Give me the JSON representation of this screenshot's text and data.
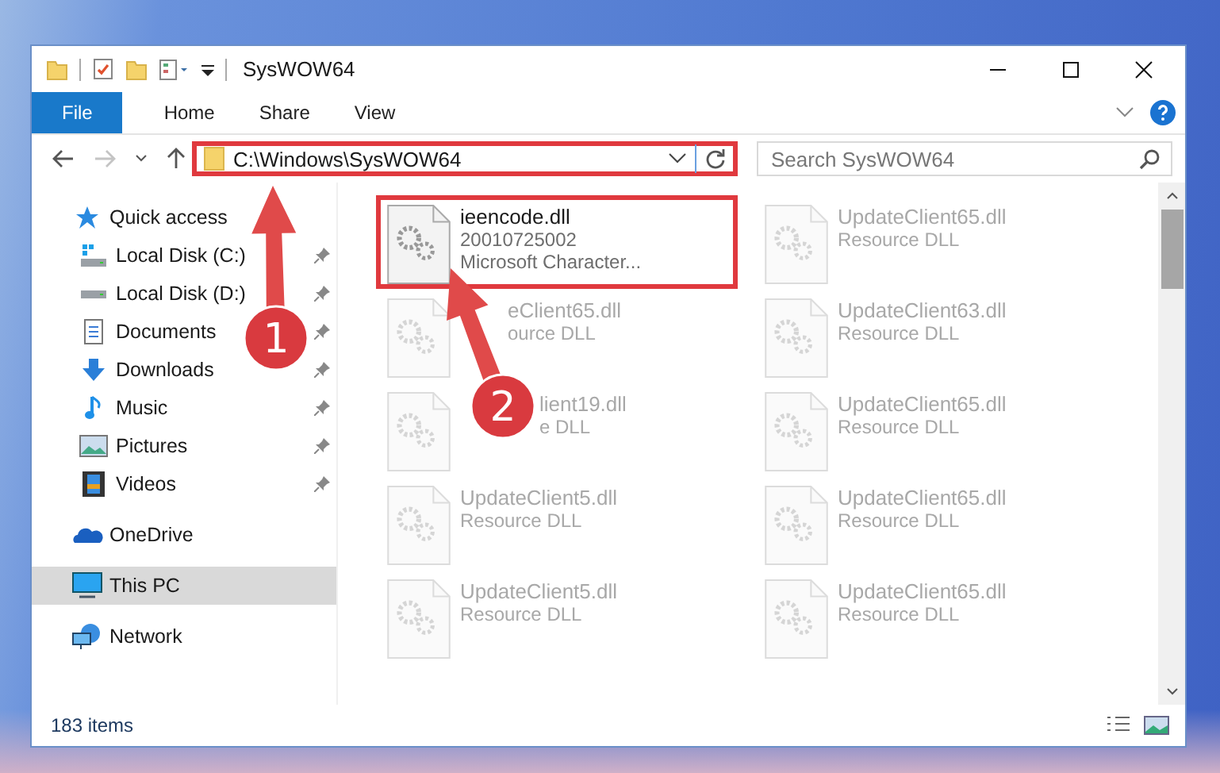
{
  "window": {
    "title": "SysWOW64"
  },
  "ribbon": {
    "tabs": [
      {
        "label": "File",
        "selected": true
      },
      {
        "label": "Home",
        "selected": false
      },
      {
        "label": "Share",
        "selected": false
      },
      {
        "label": "View",
        "selected": false
      }
    ]
  },
  "address": {
    "path": "C:\\Windows\\SysWOW64",
    "highlighted": true
  },
  "search": {
    "placeholder": "Search SysWOW64"
  },
  "sidebar": {
    "items": [
      {
        "label": "Quick access",
        "kind": "star",
        "selected": false,
        "children": [
          {
            "label": "Local Disk (C:)",
            "kind": "windows-drive",
            "pinned": true,
            "selected": false
          },
          {
            "label": "Local Disk (D:)",
            "kind": "drive",
            "pinned": true,
            "selected": false
          },
          {
            "label": "Documents",
            "kind": "documents",
            "pinned": true,
            "selected": false
          },
          {
            "label": "Downloads",
            "kind": "downloads",
            "pinned": true,
            "selected": false
          },
          {
            "label": "Music",
            "kind": "music",
            "pinned": true,
            "selected": false
          },
          {
            "label": "Pictures",
            "kind": "pictures",
            "pinned": true,
            "selected": false
          },
          {
            "label": "Videos",
            "kind": "videos",
            "pinned": true,
            "selected": false
          }
        ]
      },
      {
        "label": "OneDrive",
        "kind": "cloud",
        "selected": false
      },
      {
        "label": "This PC",
        "kind": "pc",
        "selected": true
      },
      {
        "label": "Network",
        "kind": "network",
        "selected": false
      }
    ]
  },
  "files": [
    {
      "name": "ieencode.dll",
      "lines": [
        "20010725002",
        "Microsoft Character..."
      ],
      "highlighted": true,
      "faded": false
    },
    {
      "name": "UpdateClient65.dll",
      "lines": [
        "Resource DLL"
      ],
      "highlighted": false,
      "faded": true
    },
    {
      "name": "eClient65.dll",
      "lines": [
        "ource DLL"
      ],
      "highlighted": false,
      "faded": true,
      "kind": "under-arrow"
    },
    {
      "name": "UpdateClient63.dll",
      "lines": [
        "Resource DLL"
      ],
      "highlighted": false,
      "faded": true
    },
    {
      "name": "lient19.dll",
      "lines": [
        "e DLL"
      ],
      "highlighted": false,
      "faded": true,
      "kind": "under-badge"
    },
    {
      "name": "UpdateClient65.dll",
      "lines": [
        "Resource DLL"
      ],
      "highlighted": false,
      "faded": true
    },
    {
      "name": "UpdateClient5.dll",
      "lines": [
        "Resource DLL"
      ],
      "highlighted": false,
      "faded": true
    },
    {
      "name": "UpdateClient65.dll",
      "lines": [
        "Resource DLL"
      ],
      "highlighted": false,
      "faded": true
    },
    {
      "name": "UpdateClient5.dll",
      "lines": [
        "Resource DLL"
      ],
      "highlighted": false,
      "faded": true
    },
    {
      "name": "UpdateClient65.dll",
      "lines": [
        "Resource DLL"
      ],
      "highlighted": false,
      "faded": true
    }
  ],
  "status_bar": {
    "count": "183 items"
  },
  "callouts": [
    {
      "number": "1"
    },
    {
      "number": "2"
    }
  ]
}
